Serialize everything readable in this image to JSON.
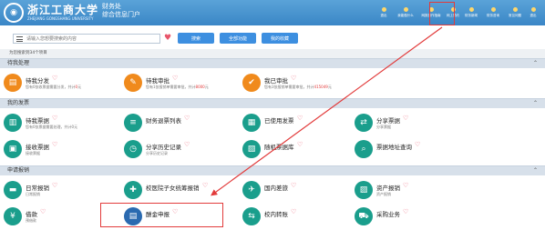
{
  "header": {
    "university_cn": "浙江工商大学",
    "university_en": "ZHEJIANG GONGSHANG UNIVERSITY",
    "portal_title_1": "财务处",
    "portal_title_2": "综合信息门户",
    "nav": [
      "退出",
      "我能做什么",
      "网报操作指南",
      "网上预约",
      "财务新闻",
      "财务咨询",
      "常见问题",
      "退出"
    ],
    "highlight_index": 1
  },
  "search": {
    "placeholder": "请输入您想要搜索的内容",
    "search_label": "搜索",
    "all_functions_label": "全部功能",
    "my_favorites_label": "我的收藏",
    "result_count": "为您搜索到34个项目"
  },
  "sections": [
    {
      "title": "待我处理",
      "cards": [
        {
          "title": "待我分发",
          "sub_pre": "您有0张收票据需要分发，共计",
          "sub_red": "0",
          "sub_post": "元",
          "color": "#f08a1c",
          "icon": "doc-icon"
        },
        {
          "title": "待我审批",
          "sub_pre": "您有1张报销单需要审批，共计",
          "sub_red": "8000",
          "sub_post": "元",
          "color": "#f08a1c",
          "icon": "stamp-icon"
        },
        {
          "title": "我已审批",
          "sub_pre": "您有3张报销单需要审批，共计",
          "sub_red": "415049",
          "sub_post": "元",
          "color": "#f08a1c",
          "icon": "check-icon"
        }
      ]
    },
    {
      "title": "我的发票",
      "cards": [
        {
          "title": "待我票据",
          "sub_pre": "您有0张票据需要处理，共计0元",
          "sub_red": "",
          "sub_post": "",
          "color": "#1a9e8c",
          "icon": "receipt-icon"
        },
        {
          "title": "财务退票列表",
          "sub_pre": "",
          "sub_red": "",
          "sub_post": "",
          "color": "#1a9e8c",
          "icon": "list-icon"
        },
        {
          "title": "已使用发票",
          "sub_pre": "",
          "sub_red": "",
          "sub_post": "",
          "color": "#1a9e8c",
          "icon": "invoice-icon"
        },
        {
          "title": "分享票据",
          "sub_pre": "分享票据",
          "sub_red": "",
          "sub_post": "",
          "color": "#1a9e8c",
          "icon": "share-icon"
        },
        {
          "title": "接收票据",
          "sub_pre": "接收票据",
          "sub_red": "",
          "sub_post": "",
          "color": "#1a9e8c",
          "icon": "inbox-icon"
        },
        {
          "title": "分享历史记录",
          "sub_pre": "分享历史记录",
          "sub_red": "",
          "sub_post": "",
          "color": "#1a9e8c",
          "icon": "history-icon"
        },
        {
          "title": "随机票据库",
          "sub_pre": "",
          "sub_red": "",
          "sub_post": "",
          "color": "#1a9e8c",
          "icon": "database-icon"
        },
        {
          "title": "票据地址查询",
          "sub_pre": "",
          "sub_red": "",
          "sub_post": "",
          "color": "#1a9e8c",
          "icon": "search-doc-icon"
        }
      ]
    },
    {
      "title": "申请报销",
      "cards": [
        {
          "title": "日常报销",
          "sub_pre": "日常报销",
          "sub_red": "",
          "sub_post": "",
          "color": "#1a9e8c",
          "icon": "wallet-icon"
        },
        {
          "title": "校医院子女统筹报销",
          "sub_pre": "",
          "sub_red": "",
          "sub_post": "",
          "color": "#1a9e8c",
          "icon": "medical-icon"
        },
        {
          "title": "国内差旅",
          "sub_pre": "",
          "sub_red": "",
          "sub_post": "",
          "color": "#1a9e8c",
          "icon": "plane-icon"
        },
        {
          "title": "资产报销",
          "sub_pre": "资产报销",
          "sub_red": "",
          "sub_post": "",
          "color": "#1a9e8c",
          "icon": "asset-icon"
        },
        {
          "title": "借款",
          "sub_pre": "预借款",
          "sub_red": "",
          "sub_post": "",
          "color": "#1a9e8c",
          "icon": "coin-icon"
        },
        {
          "title": "酬金申报",
          "sub_pre": "",
          "sub_red": "",
          "sub_post": "",
          "color": "#2a6ab0",
          "icon": "payroll-icon"
        },
        {
          "title": "校内转账",
          "sub_pre": "",
          "sub_red": "",
          "sub_post": "",
          "color": "#1a9e8c",
          "icon": "transfer-icon"
        },
        {
          "title": "采购业务",
          "sub_pre": "",
          "sub_red": "",
          "sub_post": "",
          "color": "#1a9e8c",
          "icon": "cart-icon"
        }
      ]
    }
  ]
}
